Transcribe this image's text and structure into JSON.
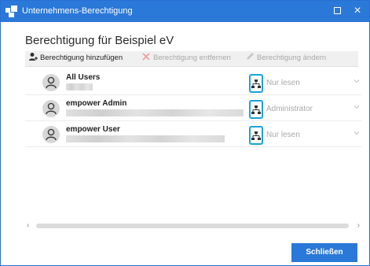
{
  "window": {
    "title": "Unternehmens-Berechtigung",
    "titlebar_color": "#2a78d8",
    "maximize_icon": "maximize-icon",
    "close_icon": "close-icon",
    "close_glyph": "×"
  },
  "heading": "Berechtigung für Beispiel eV",
  "toolbar": {
    "add_label": "Berechtigung hinzufügen",
    "remove_label": "Berechtigung entfernen",
    "change_label": "Berechtigung ändern"
  },
  "rows": [
    {
      "name": "All Users",
      "role": "Nur lesen"
    },
    {
      "name": "empower Admin",
      "role": "Administrator"
    },
    {
      "name": "empower User",
      "role": "Nur lesen"
    }
  ],
  "scroll": {
    "left_glyph": "‹",
    "right_glyph": "›"
  },
  "footer": {
    "close_label": "Schließen"
  },
  "colors": {
    "accent": "#2a78d8",
    "highlight": "#1aa3d8",
    "disabled": "#a9a9a9"
  }
}
